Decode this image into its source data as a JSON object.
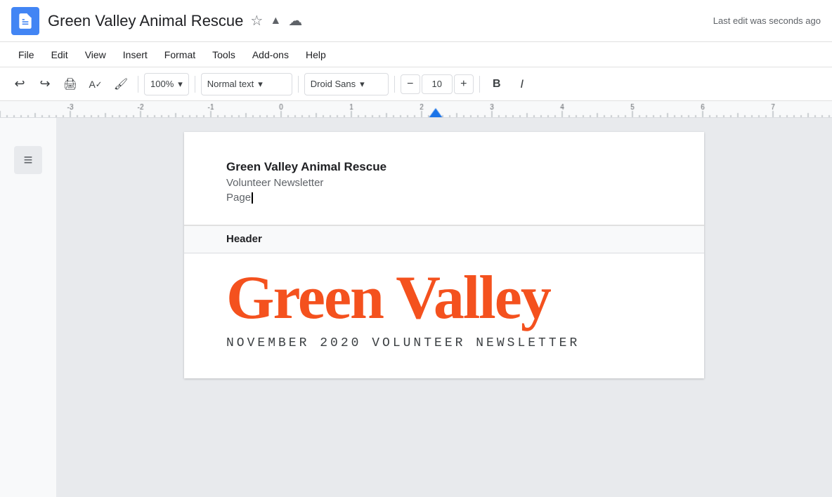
{
  "titleBar": {
    "docTitle": "Green Valley Animal Rescue",
    "lastEdit": "Last edit was seconds ago"
  },
  "menuBar": {
    "items": [
      "File",
      "Edit",
      "View",
      "Insert",
      "Format",
      "Tools",
      "Add-ons",
      "Help"
    ]
  },
  "toolbar": {
    "zoom": "100%",
    "zoomDropdown": "▾",
    "paragraphStyle": "Normal text",
    "paragraphDropdown": "▾",
    "font": "Droid Sans",
    "fontDropdown": "▾",
    "fontSize": "10",
    "boldLabel": "B",
    "italicLabel": "I"
  },
  "page": {
    "title": "Green Valley Animal Rescue",
    "subtitle": "Volunteer Newsletter",
    "cursorLine": "Page",
    "headerLabel": "Header",
    "bigTitle": "Green Valley",
    "newsletterText": "NOVEMBER 2020 VOLUNTEER NEWSLETTER"
  },
  "icons": {
    "undo": "↩",
    "redo": "↪",
    "print": "🖨",
    "paintFormat": "⌨",
    "minus": "−",
    "plus": "+",
    "star": "☆",
    "cloud": "☁",
    "driveAdd": "▲",
    "toc": "≡"
  }
}
